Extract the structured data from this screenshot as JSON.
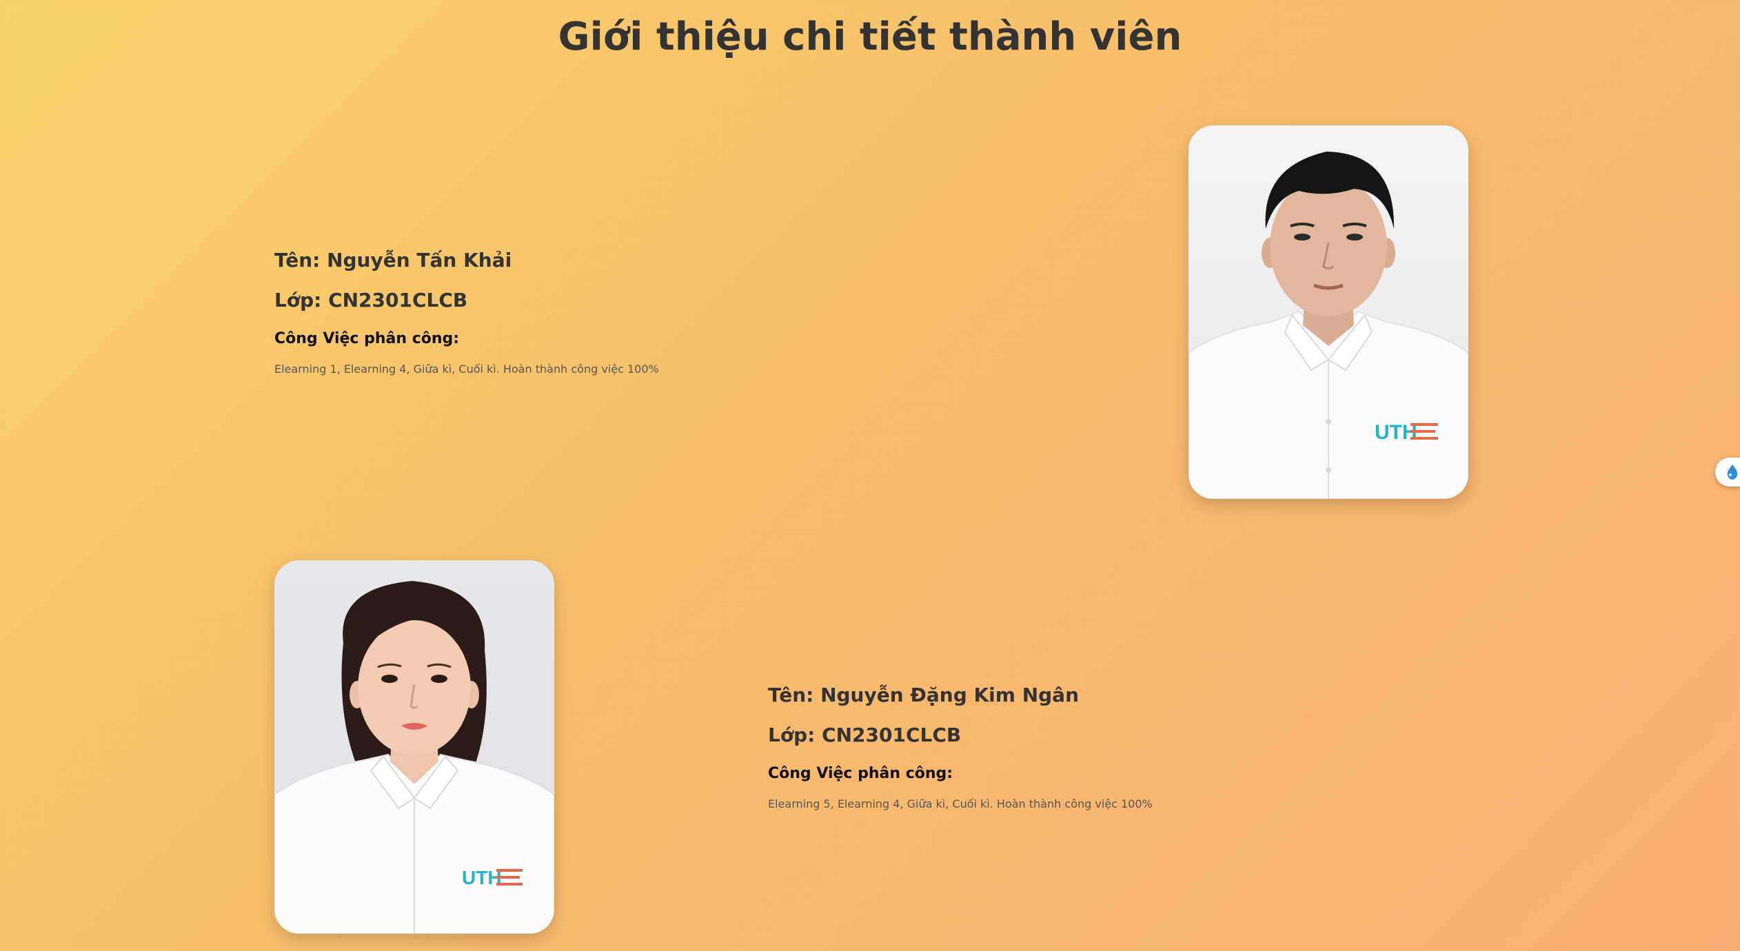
{
  "page": {
    "title": "Giới thiệu chi tiết thành viên"
  },
  "members": [
    {
      "name": "Tên: Nguyễn Tấn Khải",
      "class": "Lớp: CN2301CLCB",
      "task_heading": "Công Việc phân công:",
      "task_text": "Elearning 1, Elearning 4, Giữa kì, Cuối kì. Hoàn thành công việc 100%",
      "photo_alt": "Ảnh thẻ Nguyễn Tấn Khải",
      "photo_position": "right"
    },
    {
      "name": "Tên: Nguyễn Đặng Kim Ngân",
      "class": "Lớp: CN2301CLCB",
      "task_heading": "Công Việc phân công:",
      "task_text": "Elearning 5, Elearning 4, Giữa kì, Cuối kì. Hoàn thành công việc 100%",
      "photo_alt": "Ảnh thẻ Nguyễn Đặng Kim Ngân",
      "photo_position": "left"
    }
  ],
  "logo_text": "UTH",
  "colors": {
    "background_start": "#f8d26a",
    "background_end": "#f9ad74",
    "text_primary": "#333333",
    "widget_accent": "#2a8fe0"
  },
  "icons": {
    "side_widget": "water-drop-icon"
  }
}
